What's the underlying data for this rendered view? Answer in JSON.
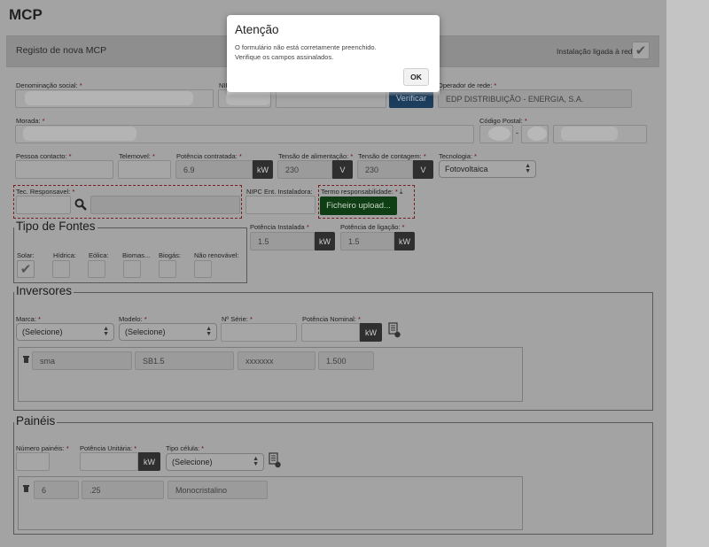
{
  "page_title": "MCP",
  "header": {
    "title": "Registo de nova MCP",
    "installation_label": "Instalação ligada à rede:",
    "installation_checked": true
  },
  "fields": {
    "denominacao_label": "Denominação social:",
    "nif_label": "NIF",
    "verificar_label": "Verificar",
    "operador_label": "Operador de rede:",
    "operador_value": "EDP DISTRIBUIÇÃO - ENERGIA, S.A.",
    "morada_label": "Morada:",
    "codigo_postal_label": "Código Postal:",
    "codigo_postal_sep": "-",
    "pessoa_label": "Pessoa contacto:",
    "telemovel_label": "Telemovel:",
    "potencia_contratada_label": "Potência contratada:",
    "potencia_contratada_value": "6.9",
    "potencia_contratada_unit": "kW",
    "tensao_alim_label": "Tensão de alimentação:",
    "tensao_alim_value": "230",
    "tensao_alim_unit": "V",
    "tensao_cont_label": "Tensão de contagem:",
    "tensao_cont_value": "230",
    "tensao_cont_unit": "V",
    "tecnologia_label": "Tecnologia:",
    "tecnologia_value": "Fotovoltaica",
    "tec_resp_label": "Tec. Responsavel:",
    "nipc_label": "NIPC Ent. Instaladora:",
    "termo_label": "Termo responsabilidade:",
    "upload_label": "Ficheiro upload...",
    "pot_instalada_label": "Potência Instalada",
    "pot_instalada_value": "1.5",
    "pot_instalada_unit": "kW",
    "pot_ligacao_label": "Potência de ligação:",
    "pot_ligacao_value": "1.5",
    "pot_ligacao_unit": "kW",
    "required_mark": "*"
  },
  "tipo_fontes": {
    "legend": "Tipo de Fontes",
    "items": [
      {
        "label": "Solar:",
        "checked": true
      },
      {
        "label": "Hídrica:",
        "checked": false
      },
      {
        "label": "Eólica:",
        "checked": false
      },
      {
        "label": "Biomas...",
        "checked": false
      },
      {
        "label": "Biogás:",
        "checked": false
      },
      {
        "label": "Não renovável:",
        "checked": false
      }
    ]
  },
  "inversores": {
    "legend": "Inversores",
    "marca_label": "Marca:",
    "marca_value": "(Selecione)",
    "modelo_label": "Modelo:",
    "modelo_value": "(Selecione)",
    "serie_label": "Nº Série:",
    "potencia_label": "Potência Nominal:",
    "potencia_unit": "kW",
    "row": [
      "sma",
      "SB1.5",
      "xxxxxxx",
      "1.500"
    ]
  },
  "paineis": {
    "legend": "Painéis",
    "numero_label": "Número painéis:",
    "potencia_label": "Potência Unitária:",
    "potencia_unit": "kW",
    "tipo_label": "Tipo célula:",
    "tipo_value": "(Selecione)",
    "row": [
      "6",
      ".25",
      "Monocristalino"
    ]
  },
  "modal": {
    "title": "Atenção",
    "line1": "O formulário não está corretamente preenchido.",
    "line2": "Verifique os campos assinalados.",
    "ok_label": "OK"
  }
}
